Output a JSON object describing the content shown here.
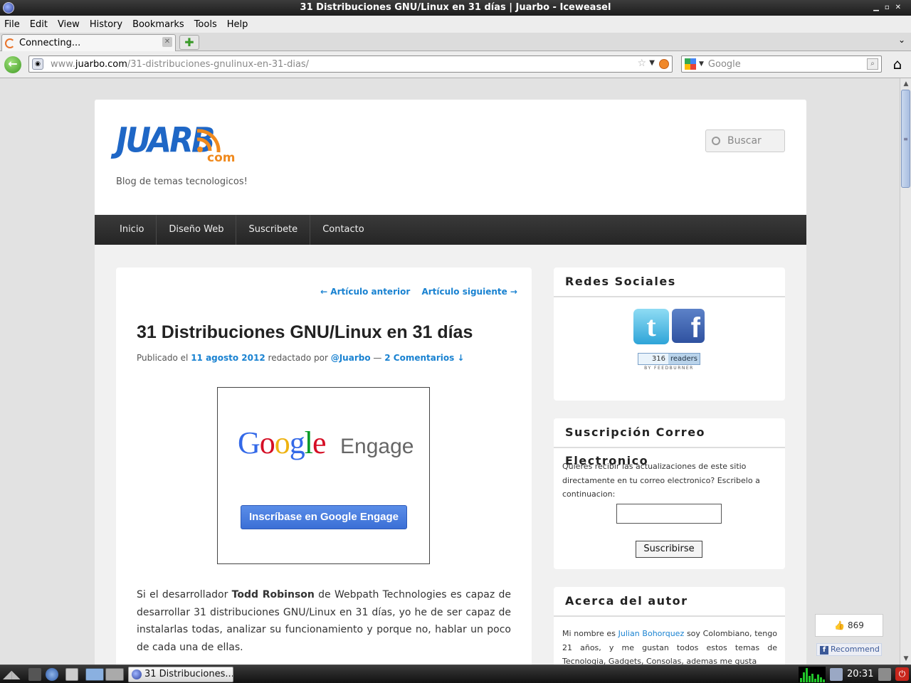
{
  "window": {
    "title": "31 Distribuciones GNU/Linux en 31 días | Juarbo - Iceweasel"
  },
  "menu": [
    "File",
    "Edit",
    "View",
    "History",
    "Bookmarks",
    "Tools",
    "Help"
  ],
  "tab": {
    "label": "Connecting...",
    "new_tab_icon": "plus-icon",
    "list_icon": "chevron-down-icon"
  },
  "navbar": {
    "url_prefix": "www.",
    "url_domain": "juarbo.com",
    "url_path": "/31-distribuciones-gnulinux-en-31-dias/",
    "search_placeholder": "Google"
  },
  "blog": {
    "logo_text": "JUARB",
    "logo_com": "com",
    "tagline": "Blog de temas tecnologicos!",
    "search_placeholder": "Buscar",
    "nav": [
      "Inicio",
      "Diseño Web",
      "Suscribete",
      "Contacto"
    ]
  },
  "post": {
    "prev_link": "← Artículo anterior",
    "next_link": "Artículo siguiente →",
    "title": "31 Distribuciones GNU/Linux en 31 días",
    "meta_published": "Publicado el",
    "meta_date": "11 agosto 2012",
    "meta_by": "redactado por",
    "meta_author": "@Juarbo",
    "meta_dash": "—",
    "meta_comments": "2 Comentarios ↓",
    "ad_google": "Google",
    "ad_engage": "Engage",
    "ad_button": "Inscríbase en Google Engage",
    "body_intro": "Si el desarrollador",
    "body_name": "Todd Robinson",
    "body_rest": "de Webpath Technologies es capaz de desarrollar 31 distribuciones GNU/Linux en 31 días, yo he de ser capaz de instalarlas todas, analizar su funcionamiento y porque no, hablar un poco de cada una de ellas."
  },
  "sidebar": {
    "social_title": "Redes Sociales",
    "twitter_glyph": "t",
    "facebook_glyph": "f",
    "feed_count": "316",
    "feed_label": "readers",
    "feed_by": "BY FEEDBURNER",
    "email_title": "Suscripción Correo Electronico",
    "email_text": "Quieres recibir las actualizaciones de este sitio directamente en tu correo electronico? Escribelo a continuacion:",
    "email_button": "Suscribirse",
    "author_title": "Acerca del autor",
    "author_pre": "Mi nombre es",
    "author_name": "Julian Bohorquez",
    "author_post": "soy Colombiano, tengo 21 años, y me gustan todos estos temas de Tecnologia, Gadgets, Consolas, ademas me gusta"
  },
  "facebook_widget": {
    "like_count": "869",
    "recommend": "Recommend"
  },
  "taskbar": {
    "task_label": "31 Distribuciones...",
    "clock": "20:31"
  },
  "colors": {
    "link": "#1982d1",
    "nav_bg": "#2c2c2c",
    "logo_blue": "#1f67c6",
    "logo_orange": "#f08a1e"
  }
}
